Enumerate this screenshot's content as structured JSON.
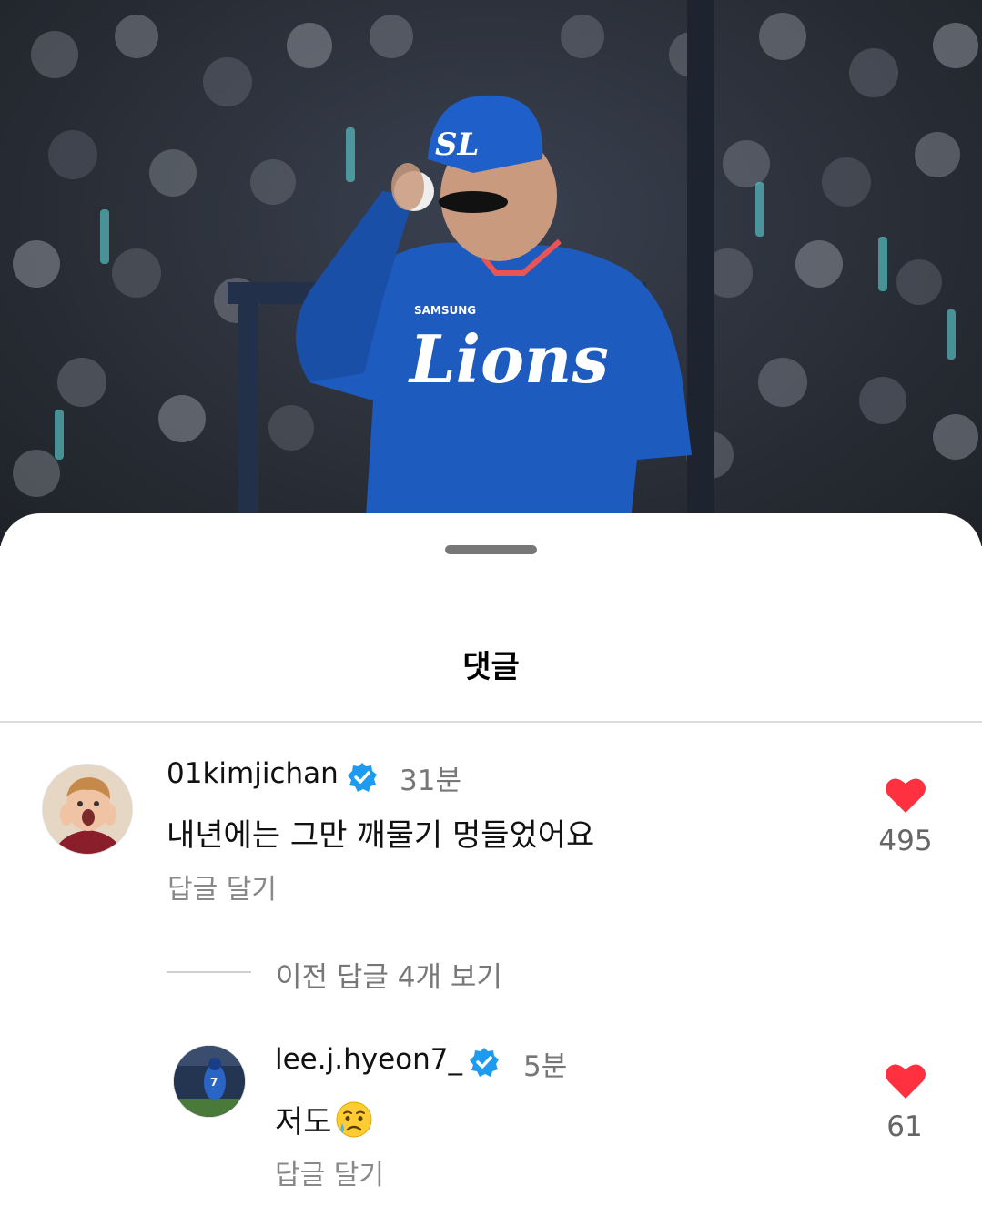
{
  "sheet": {
    "title": "댓글"
  },
  "comments": [
    {
      "username": "01kimjichan",
      "verified": true,
      "time": "31분",
      "text": "내년에는 그만 깨물기 멍들었어요",
      "reply_label": "답글 달기",
      "likes": "495",
      "like_icon": "heart-icon",
      "like_color": "#ff3040"
    }
  ],
  "prev_replies_label": "이전 답글 4개 보기",
  "replies": [
    {
      "username": "lee.j.hyeon7_",
      "verified": true,
      "time": "5분",
      "text": "저도",
      "emoji": "crying-face-emoji",
      "reply_label": "답글 달기",
      "likes": "61",
      "like_icon": "heart-icon",
      "like_color": "#ff3040"
    }
  ],
  "photo": {
    "jersey_text": "Lions",
    "cap_logo": "SL",
    "sponsor": "SAMSUNG"
  },
  "colors": {
    "verified": "#1d9bf0",
    "jersey": "#1e5bbf"
  }
}
